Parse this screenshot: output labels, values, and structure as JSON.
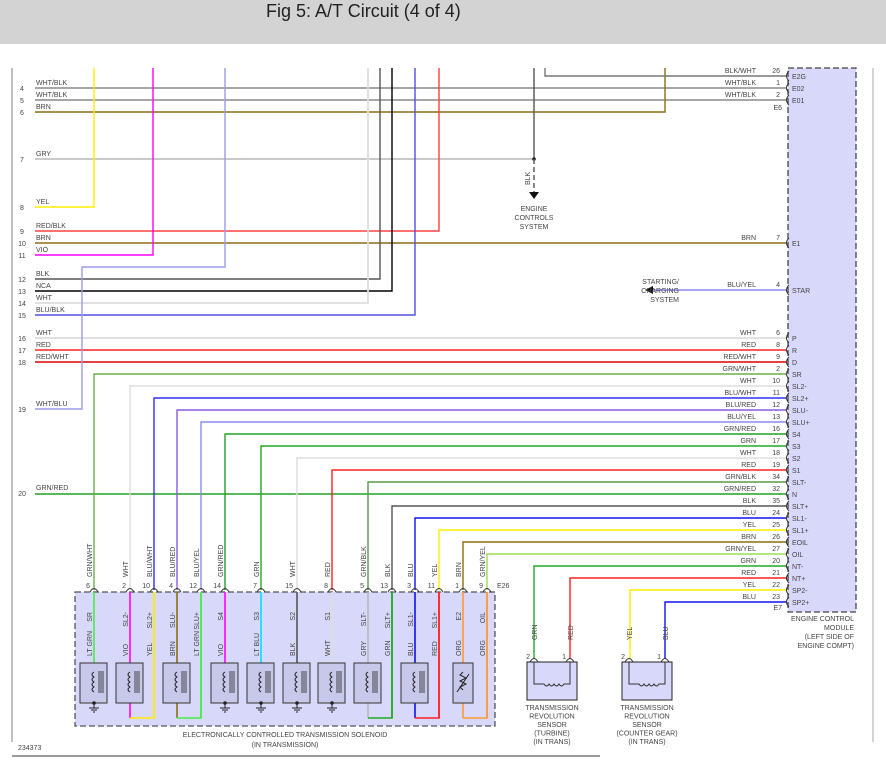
{
  "header": {
    "title": "Fig 5: A/T Circuit (4 of 4)"
  },
  "diagram_id": "234373",
  "wire_colors": {
    "WHT/BLK": "#8a8a8a",
    "BLK/WHT": "#777777",
    "BRN": "#8b6d14",
    "GRY": "#b8b8b8",
    "YEL": "#ffee00",
    "RED/BLK": "#ff4040",
    "VIO": "#ff00ff",
    "BLK": "#555555",
    "NCA": "#000000",
    "WHT": "#dddddd",
    "BLU/BLK": "#5050e0",
    "WHT/BLU": "#9a9aee",
    "RED": "#ff2020",
    "RED/WHT": "#e00000",
    "GRN/RED": "#22a022",
    "GRN/WHT": "#6ab04a",
    "BLU/WHT": "#3030f0",
    "BLU/RED": "#8a5ae0",
    "BLU/YEL": "#8a8aee",
    "GRN": "#22aa22",
    "GRN/BLK": "#5a9a4a",
    "BLU": "#1010ee",
    "GRN/YEL": "#99dd55",
    "LT GRN": "#44ee44",
    "LT BLU": "#00e0ff",
    "ORG": "#ff9930"
  },
  "left_pins": [
    {
      "pin": "4",
      "wire": "WHT/BLK"
    },
    {
      "pin": "5",
      "wire": "WHT/BLK"
    },
    {
      "pin": "6",
      "wire": "BRN"
    },
    {
      "pin": "7",
      "wire": "GRY"
    },
    {
      "pin": "8",
      "wire": "YEL"
    },
    {
      "pin": "9",
      "wire": "RED/BLK"
    },
    {
      "pin": "10",
      "wire": "BRN"
    },
    {
      "pin": "11",
      "wire": "VIO"
    },
    {
      "pin": "12",
      "wire": "BLK"
    },
    {
      "pin": "13",
      "wire": "NCA"
    },
    {
      "pin": "14",
      "wire": "WHT"
    },
    {
      "pin": "15",
      "wire": "BLU/BLK"
    },
    {
      "pin": "16",
      "wire": "WHT"
    },
    {
      "pin": "17",
      "wire": "RED"
    },
    {
      "pin": "18",
      "wire": "RED/WHT"
    },
    {
      "pin": "19",
      "wire": "WHT/BLU"
    },
    {
      "pin": "20",
      "wire": "GRN/RED"
    }
  ],
  "engine_controls": {
    "wire": "BLK",
    "label": [
      "ENGINE",
      "CONTROLS",
      "SYSTEM"
    ]
  },
  "starting_charging": {
    "label": [
      "STARTING/",
      "CHARGING",
      "SYSTEM"
    ]
  },
  "ecm": {
    "connector_e6": "E6",
    "connector_e7": "E7",
    "label": [
      "ENGINE CONTROL",
      "MODULE",
      "(LEFT SIDE OF",
      "ENGINE COMPT)"
    ],
    "pins": [
      {
        "pin": "26",
        "name": "E2G",
        "wire": "BLK/WHT"
      },
      {
        "pin": "1",
        "name": "E02",
        "wire": "WHT/BLK"
      },
      {
        "pin": "2",
        "name": "E01",
        "wire": "WHT/BLK"
      },
      {
        "pin": "7",
        "name": "E1",
        "wire": "BRN"
      },
      {
        "pin": "4",
        "name": "STAR",
        "wire": "BLU/YEL"
      },
      {
        "pin": "6",
        "name": "P",
        "wire": "WHT"
      },
      {
        "pin": "8",
        "name": "R",
        "wire": "RED"
      },
      {
        "pin": "9",
        "name": "D",
        "wire": "RED/WHT"
      },
      {
        "pin": "2",
        "name": "SR",
        "wire": "GRN/WHT"
      },
      {
        "pin": "10",
        "name": "SL2-",
        "wire": "WHT"
      },
      {
        "pin": "11",
        "name": "SL2+",
        "wire": "BLU/WHT"
      },
      {
        "pin": "12",
        "name": "SLU-",
        "wire": "BLU/RED"
      },
      {
        "pin": "13",
        "name": "SLU+",
        "wire": "BLU/YEL"
      },
      {
        "pin": "16",
        "name": "S4",
        "wire": "GRN/RED"
      },
      {
        "pin": "17",
        "name": "S3",
        "wire": "GRN"
      },
      {
        "pin": "18",
        "name": "S2",
        "wire": "WHT"
      },
      {
        "pin": "19",
        "name": "S1",
        "wire": "RED"
      },
      {
        "pin": "34",
        "name": "SLT-",
        "wire": "GRN/BLK"
      },
      {
        "pin": "32",
        "name": "N",
        "wire": "GRN/RED"
      },
      {
        "pin": "35",
        "name": "SLT+",
        "wire": "BLK"
      },
      {
        "pin": "24",
        "name": "SL1-",
        "wire": "BLU"
      },
      {
        "pin": "25",
        "name": "SL1+",
        "wire": "YEL"
      },
      {
        "pin": "26",
        "name": "EOIL",
        "wire": "BRN"
      },
      {
        "pin": "27",
        "name": "OIL",
        "wire": "GRN/YEL"
      },
      {
        "pin": "20",
        "name": "NT-",
        "wire": "GRN"
      },
      {
        "pin": "21",
        "name": "NT+",
        "wire": "RED"
      },
      {
        "pin": "22",
        "name": "SP2-",
        "wire": "YEL"
      },
      {
        "pin": "23",
        "name": "SP2+",
        "wire": "BLU"
      }
    ]
  },
  "solenoid": {
    "connector": "E26",
    "label": [
      "ELECTRONICALLY CONTROLLED TRANSMISSION SOLENOID",
      "(IN TRANSMISSION)"
    ],
    "pins": [
      {
        "pin": "6",
        "name": "SR",
        "wire": "GRN/WHT",
        "internal": "LT GRN"
      },
      {
        "pin": "2",
        "name": "SL2-",
        "wire": "WHT",
        "internal": "VIO"
      },
      {
        "pin": "10",
        "name": "SL2+",
        "wire": "BLU/WHT",
        "internal": "YEL"
      },
      {
        "pin": "4",
        "name": "SLU-",
        "wire": "BLU/RED",
        "internal": "BRN"
      },
      {
        "pin": "12",
        "name": "SLU+",
        "wire": "BLU/YEL",
        "internal": "LT GRN"
      },
      {
        "pin": "14",
        "name": "S4",
        "wire": "GRN/RED",
        "internal": "VIO"
      },
      {
        "pin": "7",
        "name": "S3",
        "wire": "GRN",
        "internal": "LT BLU"
      },
      {
        "pin": "15",
        "name": "S2",
        "wire": "WHT",
        "internal": "BLK"
      },
      {
        "pin": "8",
        "name": "S1",
        "wire": "RED",
        "internal": "WHT"
      },
      {
        "pin": "5",
        "name": "SLT-",
        "wire": "GRN/BLK",
        "internal": "GRY"
      },
      {
        "pin": "13",
        "name": "SLT+",
        "wire": "BLK",
        "internal": "GRN"
      },
      {
        "pin": "3",
        "name": "SL1-",
        "wire": "BLU",
        "internal": "BLU"
      },
      {
        "pin": "11",
        "name": "SL1+",
        "wire": "YEL",
        "internal": "RED"
      },
      {
        "pin": "1",
        "name": "E2",
        "wire": "BRN",
        "internal": "ORG"
      },
      {
        "pin": "9",
        "name": "OIL",
        "wire": "GRN/YEL",
        "internal": "ORG"
      }
    ]
  },
  "sensors": [
    {
      "pins": [
        {
          "pin": "2",
          "wire": "GRN"
        },
        {
          "pin": "1",
          "wire": "RED"
        }
      ],
      "label": [
        "TRANSMISSION",
        "REVOLUTION",
        "SENSOR",
        "(TURBINE)",
        "(IN TRANS)"
      ]
    },
    {
      "pins": [
        {
          "pin": "2",
          "wire": "YEL"
        },
        {
          "pin": "1",
          "wire": "BLU"
        }
      ],
      "label": [
        "TRANSMISSION",
        "REVOLUTION",
        "SENSOR",
        "(COUNTER GEAR)",
        "(IN TRANS)"
      ]
    }
  ]
}
